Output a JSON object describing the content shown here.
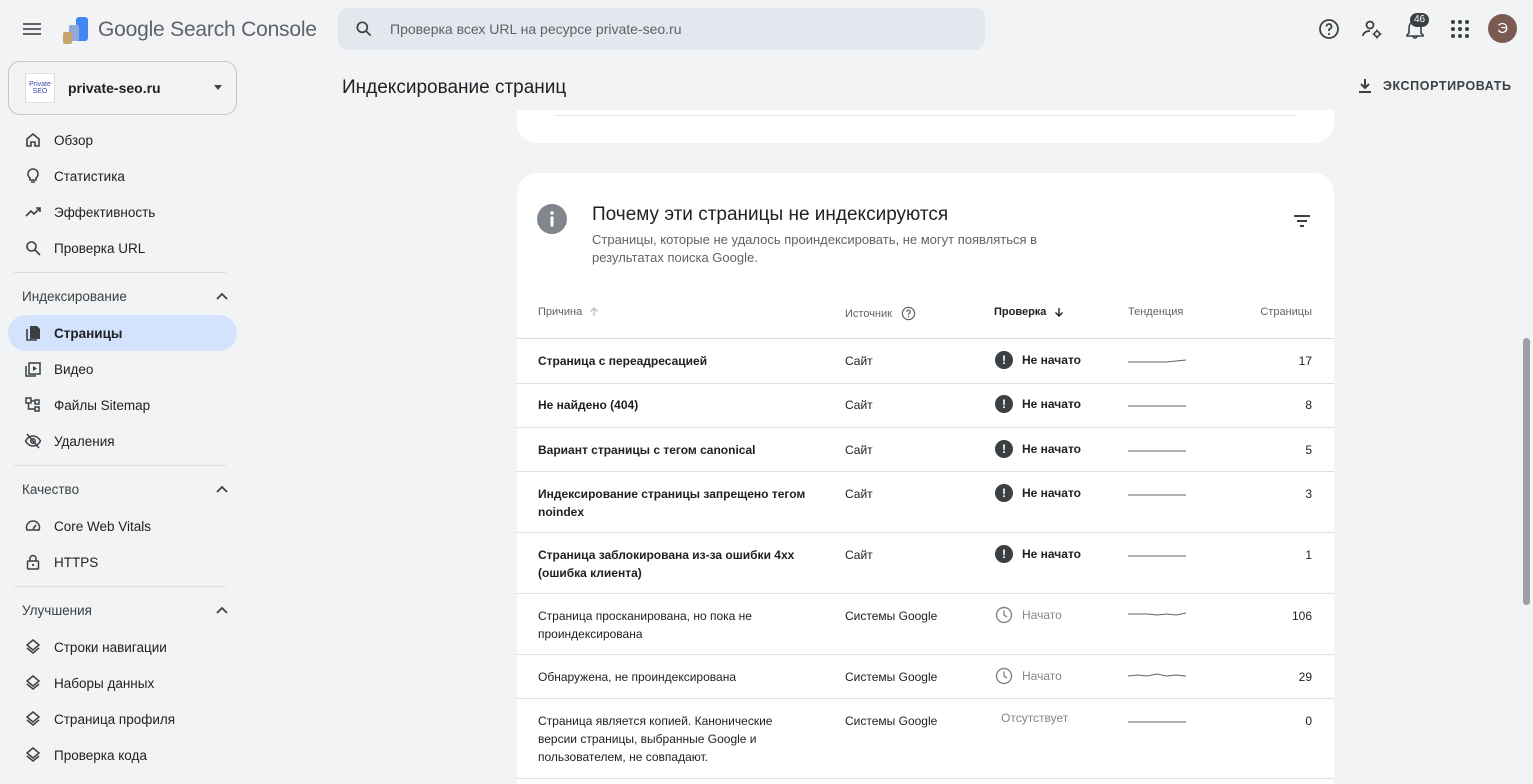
{
  "header": {
    "app_name": "Google Search Console",
    "search_placeholder": "Проверка всех URL на ресурсе private-seo.ru",
    "notifications_count": "46",
    "avatar_letter": "Э"
  },
  "property": {
    "logo_line1": "Private",
    "logo_line2": "SEO",
    "name": "private-seo.ru"
  },
  "sidebar": {
    "top_items": [
      {
        "label": "Обзор",
        "icon": "home-icon"
      },
      {
        "label": "Статистика",
        "icon": "lightbulb-icon"
      },
      {
        "label": "Эффективность",
        "icon": "trending-up-icon"
      },
      {
        "label": "Проверка URL",
        "icon": "search-icon"
      }
    ],
    "sections": [
      {
        "title": "Индексирование",
        "items": [
          {
            "label": "Страницы",
            "icon": "pages-icon",
            "active": true
          },
          {
            "label": "Видео",
            "icon": "video-icon"
          },
          {
            "label": "Файлы Sitemap",
            "icon": "sitemap-icon"
          },
          {
            "label": "Удаления",
            "icon": "eye-off-icon"
          }
        ]
      },
      {
        "title": "Качество",
        "items": [
          {
            "label": "Core Web Vitals",
            "icon": "speedometer-icon"
          },
          {
            "label": "HTTPS",
            "icon": "lock-icon"
          }
        ]
      },
      {
        "title": "Улучшения",
        "items": [
          {
            "label": "Строки навигации",
            "icon": "layers-icon"
          },
          {
            "label": "Наборы данных",
            "icon": "layers-icon"
          },
          {
            "label": "Страница профиля",
            "icon": "layers-icon"
          },
          {
            "label": "Проверка кода",
            "icon": "layers-icon"
          }
        ]
      }
    ]
  },
  "main": {
    "title": "Индексирование страниц",
    "export_label": "ЭКСПОРТИРОВАТЬ"
  },
  "card": {
    "title": "Почему эти страницы не индексируются",
    "subtitle": "Страницы, которые не удалось проиндексировать, не могут появляться в результатах поиска Google.",
    "columns": {
      "reason": "Причина",
      "source": "Источник",
      "check": "Проверка",
      "trend": "Тенденция",
      "pages": "Страницы"
    },
    "rows": [
      {
        "reason": "Страница с переадресацией",
        "source": "Сайт",
        "status": "Не начато",
        "status_type": "bad",
        "pages": "17",
        "trend": [
          10,
          10,
          10,
          10,
          10,
          9,
          8
        ]
      },
      {
        "reason": "Не найдено (404)",
        "source": "Сайт",
        "status": "Не начато",
        "status_type": "bad",
        "pages": "8",
        "trend": [
          10,
          10,
          10,
          10,
          10,
          10,
          10
        ]
      },
      {
        "reason": "Вариант страницы с тегом canonical",
        "source": "Сайт",
        "status": "Не начато",
        "status_type": "bad",
        "pages": "5",
        "trend": [
          10,
          10,
          10,
          10,
          10,
          10,
          10
        ]
      },
      {
        "reason": "Индексирование страницы запрещено тегом noindex",
        "source": "Сайт",
        "status": "Не начато",
        "status_type": "bad",
        "pages": "3",
        "trend": [
          10,
          10,
          10,
          10,
          10,
          10,
          10
        ]
      },
      {
        "reason": "Страница заблокирована из-за ошибки 4xx (ошибка клиента)",
        "source": "Сайт",
        "status": "Не начато",
        "status_type": "bad",
        "pages": "1",
        "trend": [
          10,
          10,
          10,
          10,
          10,
          10,
          10
        ]
      },
      {
        "reason": "Страница просканирована, но пока не проиндексирована",
        "source": "Системы Google",
        "status": "Начато",
        "status_type": "started",
        "pages": "106",
        "trend": [
          7,
          7,
          7,
          8,
          7,
          8,
          6
        ]
      },
      {
        "reason": "Обнаружена, не проиндексирована",
        "source": "Системы Google",
        "status": "Начато",
        "status_type": "started",
        "pages": "29",
        "trend": [
          8,
          7,
          8,
          6,
          8,
          7,
          8
        ]
      },
      {
        "reason": "Страница является копией. Канонические версии страницы, выбранные Google и пользователем, не совпадают.",
        "source": "Системы Google",
        "status": "Отсутствует",
        "status_type": "none",
        "pages": "0",
        "trend": [
          10,
          10,
          10,
          10,
          10,
          10,
          10
        ]
      }
    ]
  }
}
